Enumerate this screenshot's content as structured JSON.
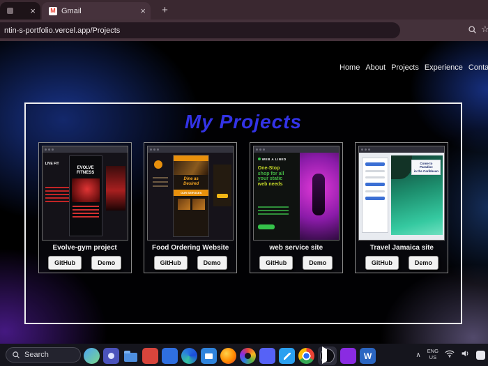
{
  "browser": {
    "tabs": [
      {
        "title": "",
        "close_glyph": "×"
      },
      {
        "title": "Gmail",
        "close_glyph": "×"
      }
    ],
    "new_tab_glyph": "+",
    "gmail_glyph": "M",
    "url": "ntin-s-portfolio.vercel.app/Projects",
    "star_glyph": "☆"
  },
  "nav": {
    "items": [
      {
        "label": "Home"
      },
      {
        "label": "About"
      },
      {
        "label": "Projects"
      },
      {
        "label": "Experience"
      },
      {
        "label": "Contact"
      }
    ]
  },
  "page": {
    "title": "My Projects"
  },
  "projects": [
    {
      "name": "Evolve-gym project",
      "github_label": "GitHub",
      "demo_label": "Demo",
      "thumb": {
        "side_text": "LIVE FIT",
        "brand_line1": "EVOLVE",
        "brand_line2": "FITNESS"
      }
    },
    {
      "name": "Food Ordering Website",
      "github_label": "GitHub",
      "demo_label": "Demo",
      "thumb": {
        "tagline_line1": "Dine as",
        "tagline_line2": "Desired",
        "services": "OUR SERVICES"
      }
    },
    {
      "name": "web service site",
      "github_label": "GitHub",
      "demo_label": "Demo",
      "thumb": {
        "brand": "WEB A LINED",
        "headline_line1": "One-Stop",
        "headline_line2": "shop for all",
        "headline_line3": "your static",
        "headline_line4": "web needs"
      }
    },
    {
      "name": "Travel Jamaica site",
      "github_label": "GitHub",
      "demo_label": "Demo",
      "thumb": {
        "headline_line1": "Come to Paradise",
        "headline_line2": "in the Caribbean"
      }
    }
  ],
  "taskbar": {
    "search_label": "Search",
    "chevron_glyph": "∧",
    "language": {
      "line1": "ENG",
      "line2": "US"
    },
    "word_glyph": "W"
  },
  "icons": {
    "toolbar": [
      "zoom-icon",
      "bookmark-star-icon"
    ],
    "taskbar": [
      "widgets-icon",
      "teams-icon",
      "file-explorer-icon",
      "red-app-icon",
      "blue-app-icon",
      "edge-icon",
      "store-icon",
      "firefox-icon",
      "photos-icon",
      "discord-icon",
      "vscode-icon",
      "chrome-icon",
      "media-player-icon",
      "purple-app-icon",
      "word-icon",
      "chevron-up-icon",
      "wifi-icon",
      "volume-icon",
      "notification-icon"
    ]
  },
  "colors": {
    "title_blue": "#3333e6",
    "tab_strip": "#3a2830",
    "toolbar": "#44313a",
    "taskbar_bg": "#15151d",
    "page_bg": "#000000",
    "button_bg": "#f2f2f2"
  }
}
